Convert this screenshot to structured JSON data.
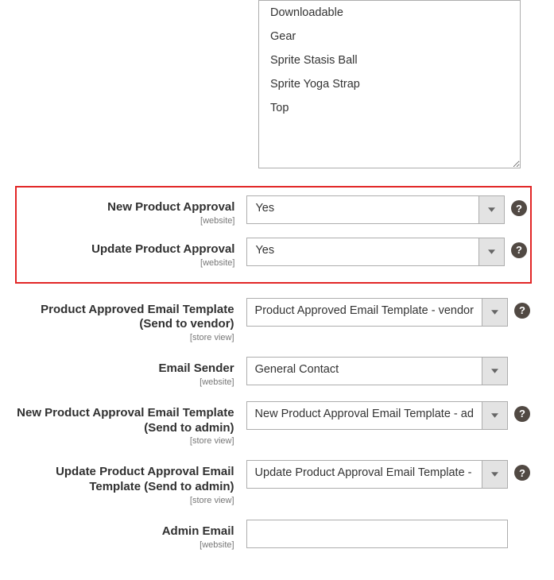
{
  "listbox": {
    "options": [
      "Downloadable",
      "Gear",
      "Sprite Stasis Ball",
      "Sprite Yoga Strap",
      "Top"
    ]
  },
  "fields": {
    "new_product_approval": {
      "label": "New Product Approval",
      "scope": "[website]",
      "value": "Yes"
    },
    "update_product_approval": {
      "label": "Update Product Approval",
      "scope": "[website]",
      "value": "Yes"
    },
    "product_approved_template": {
      "label": "Product Approved Email Template (Send to vendor)",
      "scope": "[store view]",
      "value": "Product Approved Email Template - vendor"
    },
    "email_sender": {
      "label": "Email Sender",
      "scope": "[website]",
      "value": "General Contact"
    },
    "new_product_template_admin": {
      "label": "New Product Approval Email Template (Send to admin)",
      "scope": "[store view]",
      "value": "New Product Approval Email Template - ad"
    },
    "update_product_template_admin": {
      "label": "Update Product Approval Email Template (Send to admin)",
      "scope": "[store view]",
      "value": "Update Product Approval Email Template -"
    },
    "admin_email": {
      "label": "Admin Email",
      "scope": "[website]",
      "value": ""
    }
  }
}
